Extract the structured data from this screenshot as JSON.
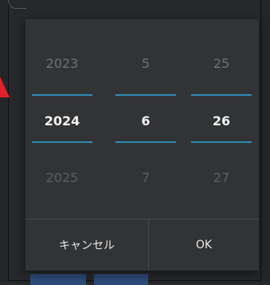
{
  "picker": {
    "year": {
      "prev": "2023",
      "current": "2024",
      "next": "2025"
    },
    "month": {
      "prev": "5",
      "current": "6",
      "next": "7"
    },
    "day": {
      "prev": "25",
      "current": "26",
      "next": "27"
    }
  },
  "buttons": {
    "cancel": "キャンセル",
    "ok": "OK"
  },
  "colors": {
    "accent": "#2f8cb3",
    "dialog_bg": "#323335",
    "annotation": "#e0202a"
  }
}
